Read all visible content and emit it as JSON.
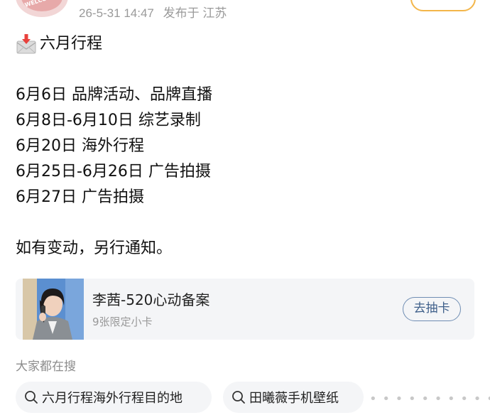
{
  "header": {
    "avatar_text": "WELCOME",
    "timestamp": "26-5-31 14:47",
    "posted_from": "发布于 江苏"
  },
  "post": {
    "title": "六月行程",
    "title_icon": "envelope-with-arrow-icon",
    "schedule": [
      "6月6日 品牌活动、品牌直播",
      "6月8日-6月10日 综艺录制",
      "6月20日 海外行程",
      "6月25日-6月26日 广告拍摄",
      "6月27日 广告拍摄"
    ],
    "footer_note": "如有变动，另行通知。"
  },
  "card": {
    "title": "李茜-520心动备案",
    "subtitle": "9张限定小卡",
    "button_label": "去抽卡"
  },
  "search": {
    "heading": "大家都在搜",
    "icon": "search-icon",
    "suggestions": [
      "六月行程海外行程目的地",
      "田曦薇手机壁纸"
    ]
  },
  "colors": {
    "meta_gray": "#9a9a9a",
    "card_bg": "#f4f5f7",
    "button_border": "#6f8db3",
    "button_text": "#3e5f8a",
    "follow_border": "#f3b64a"
  }
}
